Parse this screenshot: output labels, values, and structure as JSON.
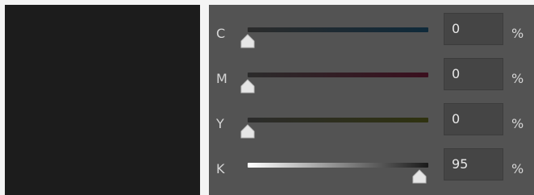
{
  "swatch_color": "#1c1c1c",
  "channels": [
    {
      "label": "C",
      "value": "0",
      "unit": "%",
      "level": 0,
      "track_start": "#2b2b2b",
      "track_end": "#0f2a3a"
    },
    {
      "label": "M",
      "value": "0",
      "unit": "%",
      "level": 0,
      "track_start": "#2b2b2b",
      "track_end": "#3a0f1e"
    },
    {
      "label": "Y",
      "value": "0",
      "unit": "%",
      "level": 0,
      "track_start": "#2b2b2b",
      "track_end": "#2f3210"
    },
    {
      "label": "K",
      "value": "95",
      "unit": "%",
      "level": 95,
      "track_start": "#ffffff",
      "track_end": "#1a1a1a"
    }
  ]
}
